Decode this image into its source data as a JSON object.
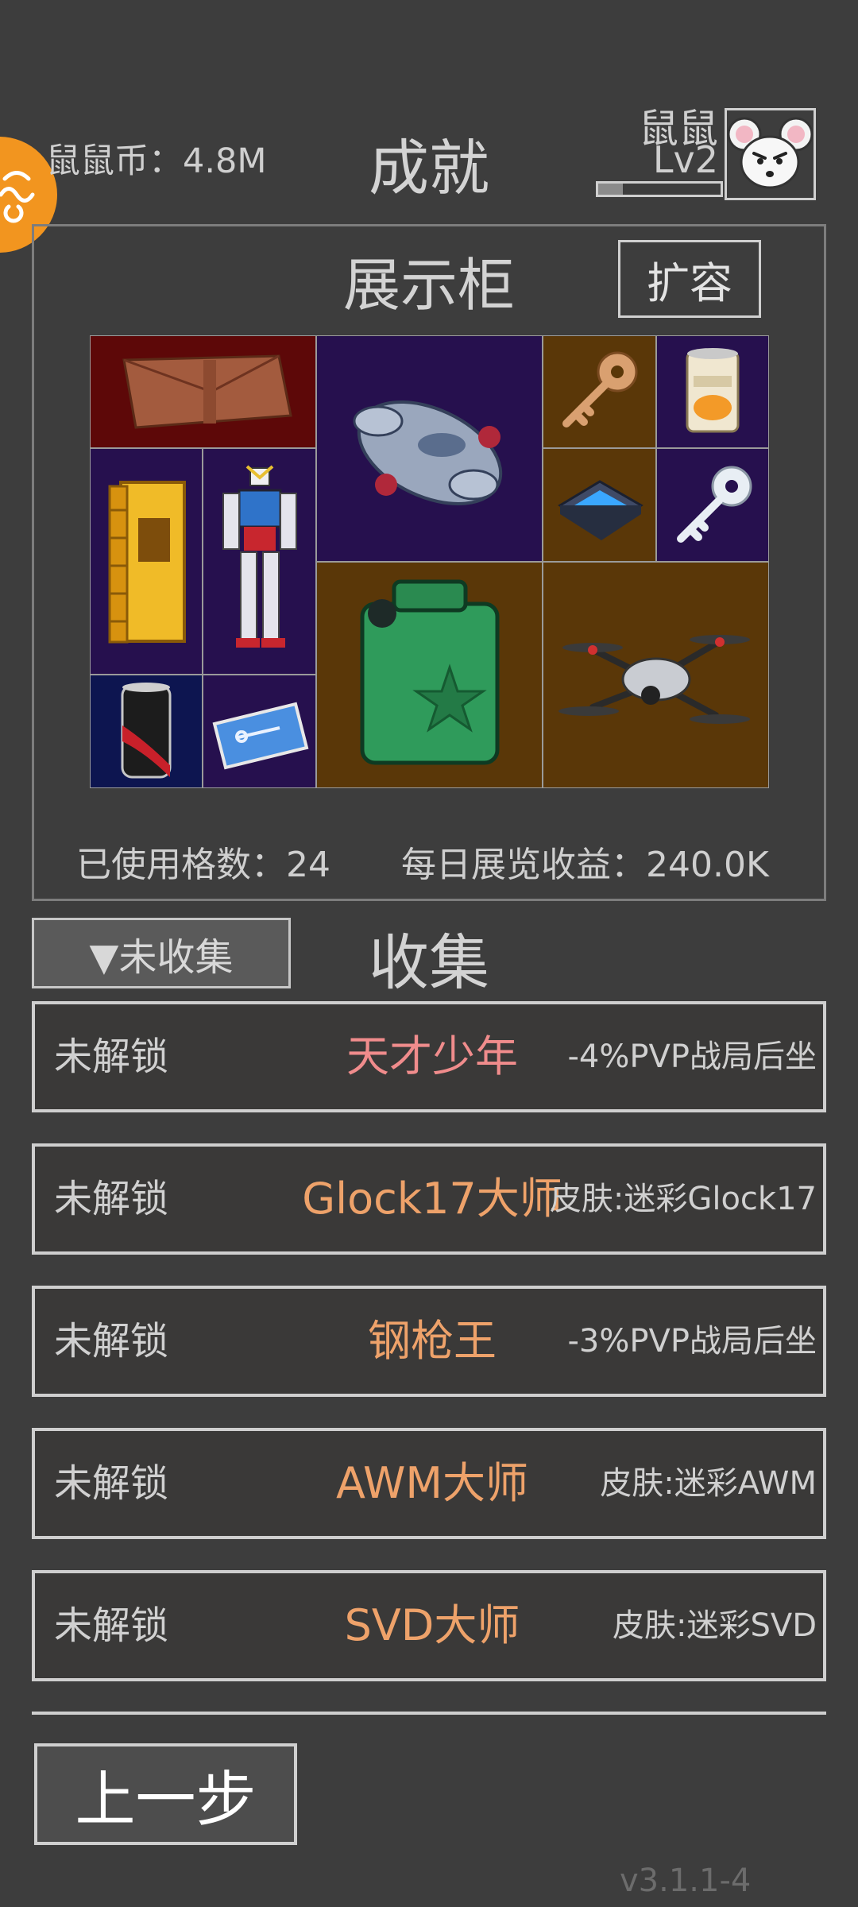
{
  "header": {
    "coins": "鼠鼠币：4.8M",
    "title": "成就",
    "player_name": "鼠鼠",
    "player_level": "Lv2",
    "xp_fraction": 0.2
  },
  "cabinet": {
    "title": "展示柜",
    "expand_label": "扩容",
    "used_cells": "已使用格数：24",
    "daily_income": "每日展览收益：240.0K",
    "items": [
      {
        "name": "leather-wallet",
        "bg": "#5d0808"
      },
      {
        "name": "spaceship",
        "bg": "#26104e"
      },
      {
        "name": "bronze-key",
        "bg": "#5a3708"
      },
      {
        "name": "canned-peaches",
        "bg": "#26104e"
      },
      {
        "name": "gold-book",
        "bg": "#26104e"
      },
      {
        "name": "mecha-robot",
        "bg": "#26104e"
      },
      {
        "name": "cpu-chip",
        "bg": "#5a3708"
      },
      {
        "name": "silver-key",
        "bg": "#26104e"
      },
      {
        "name": "jerry-can",
        "bg": "#5a3708"
      },
      {
        "name": "drone",
        "bg": "#5a3708"
      },
      {
        "name": "soda-can",
        "bg": "#0d1550"
      },
      {
        "name": "key-card",
        "bg": "#26104e"
      }
    ]
  },
  "collection": {
    "filter_label": "▼未收集",
    "title": "收集",
    "rows": [
      {
        "status": "未解锁",
        "name": "天才少年",
        "reward": "-4%PVP战局后坐",
        "color": "#f08c8c"
      },
      {
        "status": "未解锁",
        "name": "Glock17大师",
        "reward": "皮肤:迷彩Glock17",
        "color": "#eea26a"
      },
      {
        "status": "未解锁",
        "name": "钢枪王",
        "reward": "-3%PVP战局后坐",
        "color": "#eea26a"
      },
      {
        "status": "未解锁",
        "name": "AWM大师",
        "reward": "皮肤:迷彩AWM",
        "color": "#eea26a"
      },
      {
        "status": "未解锁",
        "name": "SVD大师",
        "reward": "皮肤:迷彩SVD",
        "color": "#eea26a"
      }
    ]
  },
  "footer": {
    "back_label": "上一步",
    "version": "v3.1.1-4"
  }
}
